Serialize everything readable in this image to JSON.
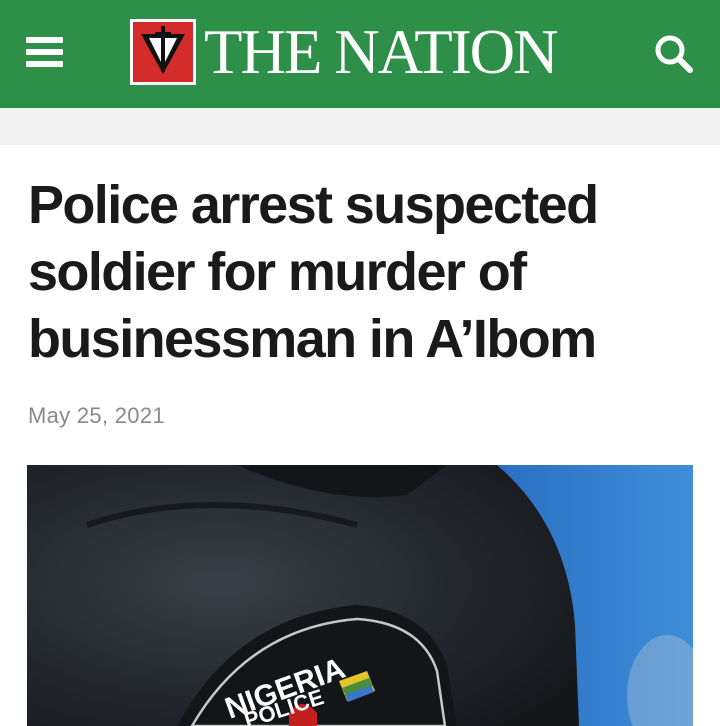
{
  "header": {
    "site_name": "THE NATION",
    "background_color": "#2e8f48",
    "menu_icon": "hamburger-menu-icon",
    "search_icon": "search-icon",
    "logo_badge_color": "#d42b2b"
  },
  "article": {
    "title": "Police arrest suspected soldier for murder of businessman in A’Ibom",
    "date": "May 25, 2021"
  },
  "hero_image": {
    "patch_text_top": "NIGERIA",
    "patch_text_bottom": "POLICE"
  }
}
